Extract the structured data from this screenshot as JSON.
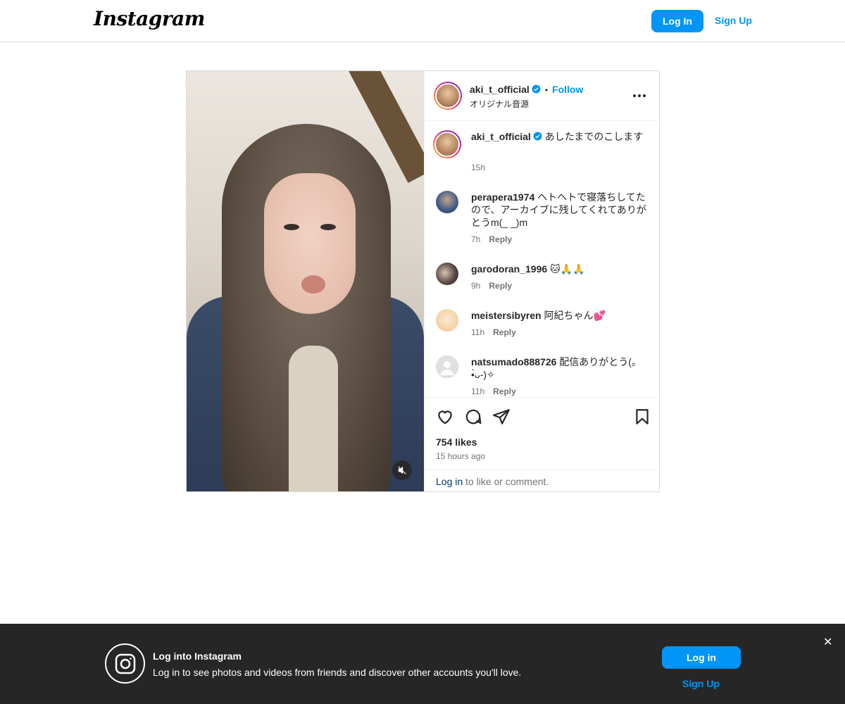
{
  "nav": {
    "logo": "Instagram",
    "login_label": "Log In",
    "signup_label": "Sign Up"
  },
  "post": {
    "author": "aki_t_official",
    "dot": "•",
    "follow_label": "Follow",
    "audio_label": "オリジナル音源",
    "caption_user": "aki_t_official",
    "caption_text": "あしたまでのこします",
    "caption_time": "15h",
    "comments": [
      {
        "user": "perapera1974",
        "text": "ヘトヘトで寝落ちしてたので、アーカイブに残してくれてありがとうm(_ _)m",
        "time": "7h",
        "reply": "Reply"
      },
      {
        "user": "garodoran_1996",
        "text": "🐱🙏🙏",
        "time": "9h",
        "reply": "Reply"
      },
      {
        "user": "meistersibyren",
        "text": "阿紀ちゃん💕",
        "time": "11h",
        "reply": "Reply"
      },
      {
        "user": "natsumado888726",
        "text": "配信ありがとう(｡•̀ᴗ-)✧",
        "time": "11h",
        "reply": "Reply"
      }
    ],
    "likes": "754 likes",
    "posted": "15 hours ago",
    "login_link": "Log in",
    "login_suffix": " to like or comment."
  },
  "icons": {
    "like": "heart-icon",
    "comment": "comment-icon",
    "share": "share-icon",
    "save": "bookmark-icon",
    "more": "more-options-icon",
    "mute": "muted-audio-icon",
    "verified": "verified-badge-icon",
    "close": "close-icon"
  },
  "banner": {
    "title": "Log into Instagram",
    "subtitle": "Log in to see photos and videos from friends and discover other accounts you'll love.",
    "login_label": "Log in",
    "signup_label": "Sign Up",
    "close": "✕"
  },
  "colors": {
    "accent": "#0095f6",
    "banner_bg": "#262626",
    "link_dark": "#00376b"
  }
}
